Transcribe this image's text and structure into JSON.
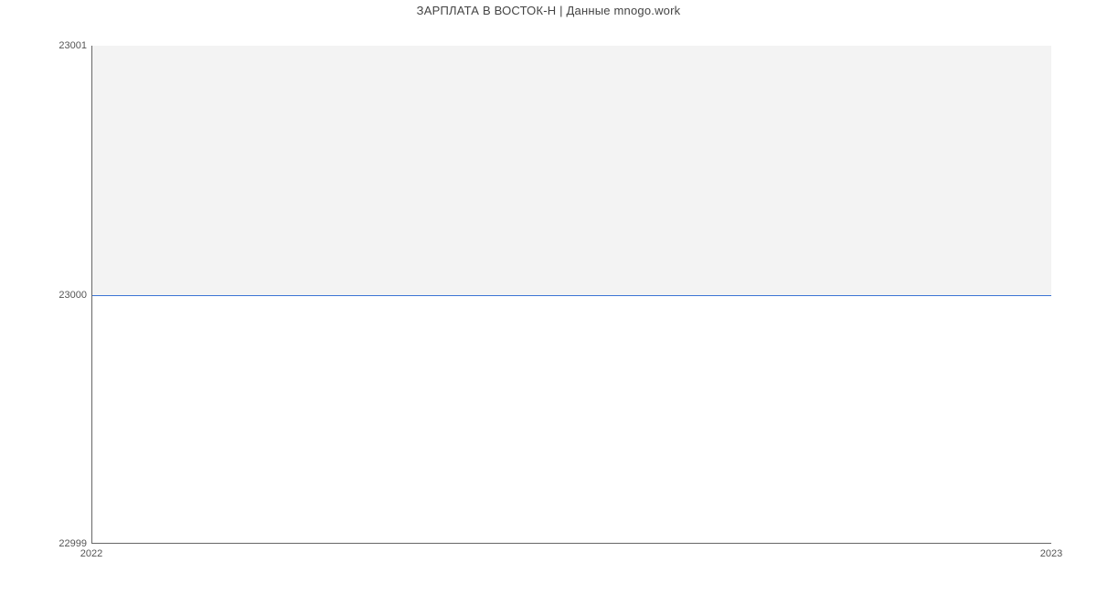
{
  "chart_data": {
    "type": "line",
    "title": "ЗАРПЛАТА В ВОСТОК-Н | Данные mnogo.work",
    "x": [
      2022,
      2023
    ],
    "values": [
      23000,
      23000
    ],
    "xlabel": "",
    "ylabel": "",
    "xlim": [
      2022,
      2023
    ],
    "ylim": [
      22999,
      23001
    ],
    "x_ticks": [
      2022,
      2023
    ],
    "y_ticks": [
      22999,
      23000,
      23001
    ],
    "grid": false,
    "plot_background_fill": true
  }
}
